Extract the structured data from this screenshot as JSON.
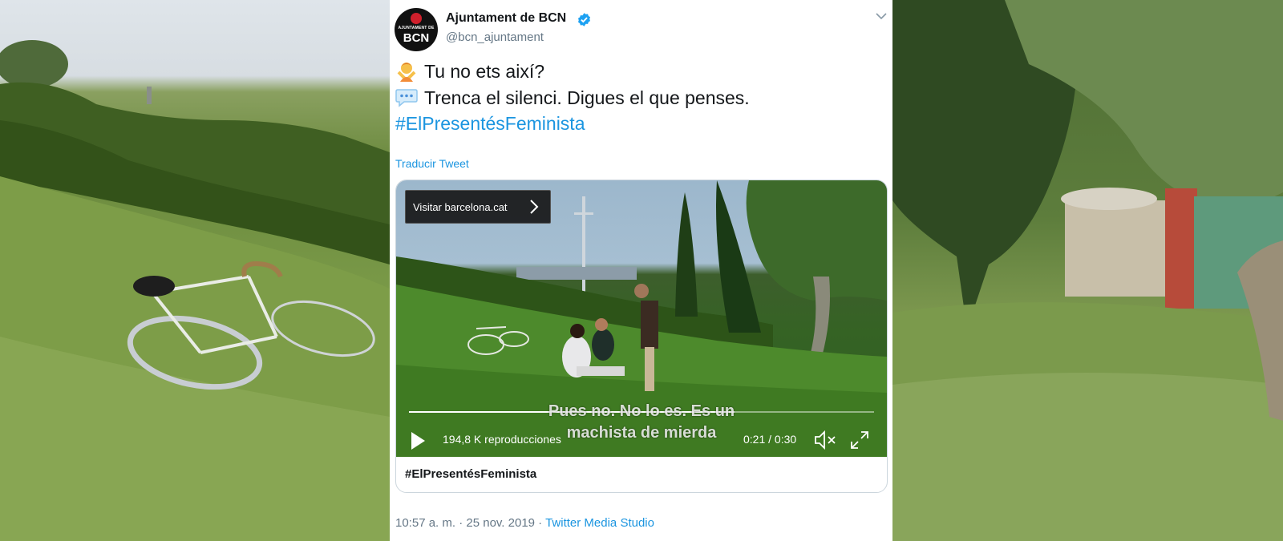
{
  "tweet": {
    "author_name": "Ajuntament de BCN",
    "author_handle": "@bcn_ajuntament",
    "avatar_text_small": "AJUNTAMENT DE",
    "avatar_text_big": "BCN",
    "text_line1": "Tu no ets així?",
    "text_line2": "Trenca el silenci. Digues el que penses.",
    "hashtag": "#ElPresentésFeminista",
    "translate_label": "Traducir Tweet",
    "timestamp": "10:57 a. m. · 25 nov. 2019",
    "separator": " · ",
    "source": "Twitter Media Studio"
  },
  "media": {
    "visit_label": "Visitar barcelona.cat",
    "subtitle_line1": "Pues no. No lo es. Es un",
    "subtitle_line2": "machista de mierda",
    "views": "194,8 K reproducciones",
    "time": "0:21 / 0:30",
    "progress": 0.7,
    "card_title": "#ElPresentésFeminista"
  },
  "icons": {
    "line1_emoji": "person-gesturing-no-icon",
    "line2_emoji": "speech-balloon-icon",
    "verified": "verified-badge-icon"
  },
  "colors": {
    "link": "#1b95e0",
    "text": "#14171a",
    "secondary": "#657786",
    "verified": "#1da1f2"
  }
}
